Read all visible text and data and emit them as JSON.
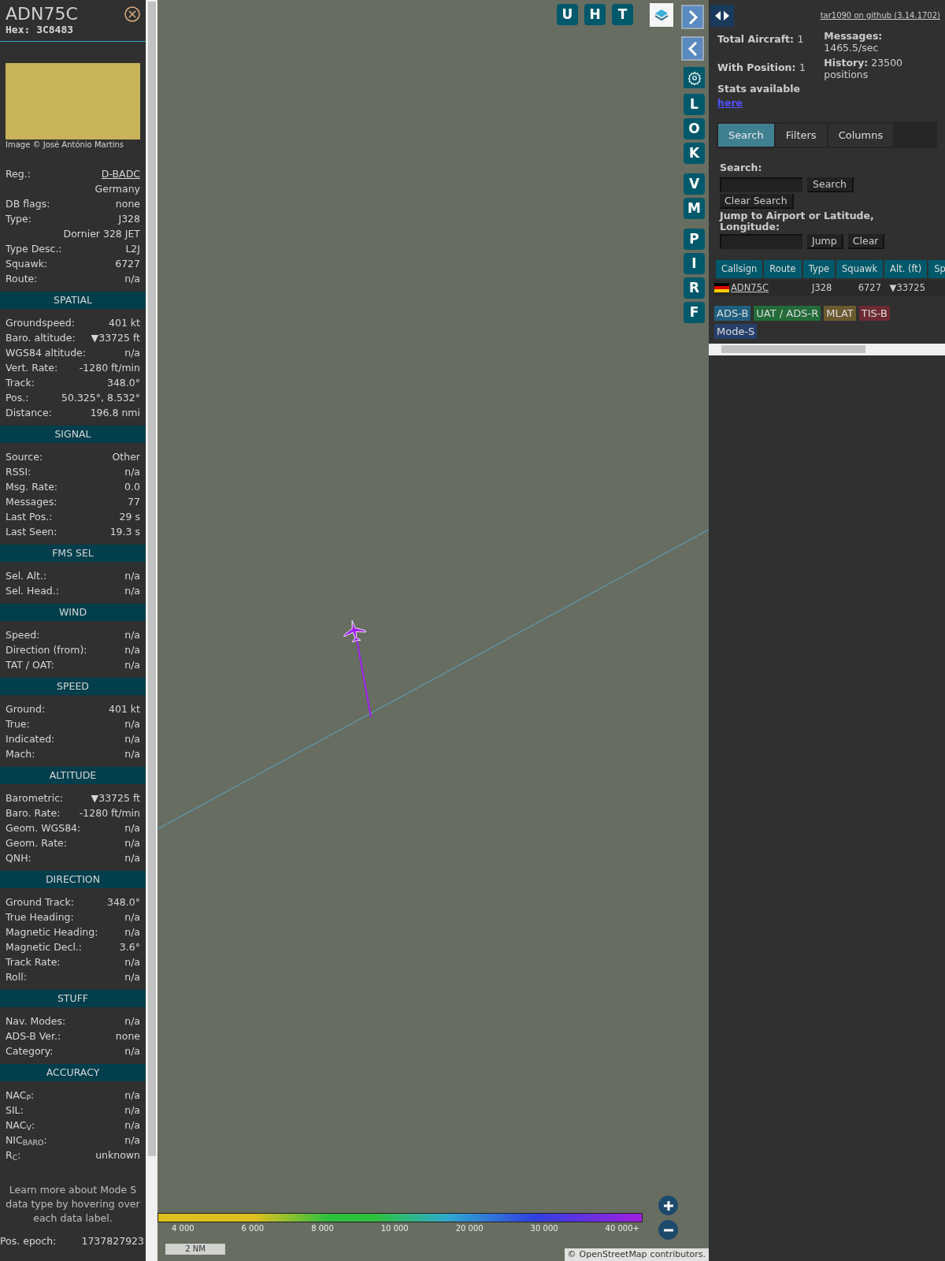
{
  "aircraft": {
    "callsign": "ADN75C",
    "hex": "Hex: 3C8483",
    "photo_caption": "Image © José António Martins"
  },
  "details": [
    {
      "label": "Reg.:",
      "value": "D-BADC",
      "kind": "link"
    },
    {
      "value": "Germany",
      "kind": "text"
    },
    {
      "label": "DB flags:",
      "value": "none",
      "kind": "text"
    },
    {
      "label": "Type:",
      "value": "J328",
      "kind": "text"
    },
    {
      "value": "Dornier 328 JET",
      "kind": "text"
    },
    {
      "label": "Type Desc.:",
      "value": "L2J",
      "kind": "text"
    },
    {
      "label": "Squawk:",
      "value": "6727",
      "kind": "text"
    },
    {
      "label": "Route:",
      "value": "n/a",
      "kind": "text"
    }
  ],
  "sections": [
    {
      "title": "SPATIAL",
      "rows": [
        {
          "label": "Groundspeed:",
          "value": "401 kt"
        },
        {
          "label": "Baro. altitude:",
          "value": "▼33725 ft"
        },
        {
          "label": "WGS84 altitude:",
          "value": "n/a"
        },
        {
          "label": "Vert. Rate:",
          "value": "-1280 ft/min"
        },
        {
          "label": "Track:",
          "value": "348.0°"
        },
        {
          "label": "Pos.:",
          "value": "50.325°, 8.532°"
        },
        {
          "label": "Distance:",
          "value": "196.8 nmi"
        }
      ]
    },
    {
      "title": "SIGNAL",
      "rows": [
        {
          "label": "Source:",
          "value": "Other"
        },
        {
          "label": "RSSI:",
          "value": "n/a"
        },
        {
          "label": "Msg. Rate:",
          "value": "0.0"
        },
        {
          "label": "Messages:",
          "value": "77"
        },
        {
          "label": "Last Pos.:",
          "value": "29 s"
        },
        {
          "label": "Last Seen:",
          "value": "19.3 s"
        }
      ]
    },
    {
      "title": "FMS SEL",
      "rows": [
        {
          "label": "Sel. Alt.:",
          "value": "n/a"
        },
        {
          "label": "Sel. Head.:",
          "value": "n/a"
        }
      ]
    },
    {
      "title": "WIND",
      "rows": [
        {
          "label": "Speed:",
          "value": "n/a"
        },
        {
          "label": "Direction (from):",
          "value": "n/a"
        },
        {
          "label": "TAT / OAT:",
          "value": "n/a"
        }
      ]
    },
    {
      "title": "SPEED",
      "rows": [
        {
          "label": "Ground:",
          "value": "401 kt"
        },
        {
          "label": "True:",
          "value": "n/a"
        },
        {
          "label": "Indicated:",
          "value": "n/a"
        },
        {
          "label": "Mach:",
          "value": "n/a"
        }
      ]
    },
    {
      "title": "ALTITUDE",
      "rows": [
        {
          "label": "Barometric:",
          "value": "▼33725 ft"
        },
        {
          "label": "Baro. Rate:",
          "value": "-1280 ft/min"
        },
        {
          "label": "Geom. WGS84:",
          "value": "n/a"
        },
        {
          "label": "Geom. Rate:",
          "value": "n/a"
        },
        {
          "label": "QNH:",
          "value": "n/a"
        }
      ]
    },
    {
      "title": "DIRECTION",
      "rows": [
        {
          "label": "Ground Track:",
          "value": "348.0°"
        },
        {
          "label": "True Heading:",
          "value": "n/a"
        },
        {
          "label": "Magnetic Heading:",
          "value": "n/a"
        },
        {
          "label": "Magnetic Decl.:",
          "value": "3.6°"
        },
        {
          "label": "Track Rate:",
          "value": "n/a"
        },
        {
          "label": "Roll:",
          "value": "n/a"
        }
      ]
    },
    {
      "title": "STUFF",
      "rows": [
        {
          "label": "Nav. Modes:",
          "value": "n/a"
        },
        {
          "label": "ADS-B Ver.:",
          "value": "none"
        },
        {
          "label": "Category:",
          "value": "n/a"
        }
      ]
    },
    {
      "title": "ACCURACY",
      "rows": [
        {
          "label": "NAC$_{P}$:",
          "value": "n/a"
        },
        {
          "label": "SIL:",
          "value": "n/a"
        },
        {
          "label": "NAC$_{V}$:",
          "value": "n/a"
        },
        {
          "label": "NIC$_{BARO}$:",
          "value": "n/a"
        },
        {
          "label": "R$_{C}$:",
          "value": "unknown"
        }
      ]
    }
  ],
  "sidebar_note": "Learn more about Mode S data type by hovering over each data label.",
  "pos_epoch": {
    "label": "Pos. epoch:",
    "value": "1737827923"
  },
  "map": {
    "top_buttons": [
      "U",
      "H",
      "T"
    ],
    "side_buttons": [
      "L",
      "O",
      "K",
      "V",
      "M",
      "P",
      "I",
      "R",
      "F"
    ],
    "legend_labels": [
      "4 000",
      "6 000",
      "8 000",
      "10 000",
      "20 000",
      "30 000",
      "40 000+"
    ],
    "scale": "2 NM",
    "attribution_prefix": "©",
    "attribution_link": "OpenStreetMap",
    "attribution_suffix": "contributors."
  },
  "panel": {
    "version_link": "tar1090 on github (3.14.1702)",
    "stats": [
      {
        "label": "Total Aircraft:",
        "value": "1"
      },
      {
        "label": "With Position:",
        "value": "1"
      }
    ],
    "stats_available": "Stats available",
    "stats_link": "here",
    "messages_label": "Messages:",
    "messages_value": "1465.5/sec",
    "history_label": "History:",
    "history_value": "23500 positions",
    "tabs": [
      {
        "label": "Search",
        "selected": true
      },
      {
        "label": "Filters",
        "selected": false
      },
      {
        "label": "Columns",
        "selected": false
      }
    ],
    "search_label": "Search:",
    "search_button": "Search",
    "clear_search_button": "Clear Search",
    "jump_label": "Jump to Airport or Latitude, Longitude:",
    "jump_button": "Jump",
    "clear_button": "Clear",
    "table": {
      "columns": [
        "Callsign",
        "Route",
        "Type",
        "Squawk",
        "Alt. (ft)",
        "Sp"
      ],
      "rows": [
        {
          "callsign": "ADN75C",
          "route": "",
          "type": "J328",
          "squawk": "6727",
          "altitude": "▼33725"
        }
      ]
    },
    "sources": [
      {
        "label": "ADS-B",
        "color": "#1f5f7f"
      },
      {
        "label": "UAT / ADS-R",
        "color": "#236b38"
      },
      {
        "label": "MLAT",
        "color": "#6b5a2e"
      },
      {
        "label": "TIS-B",
        "color": "#6e2a33"
      },
      {
        "label": "Mode-S",
        "color": "#26406b"
      }
    ]
  }
}
